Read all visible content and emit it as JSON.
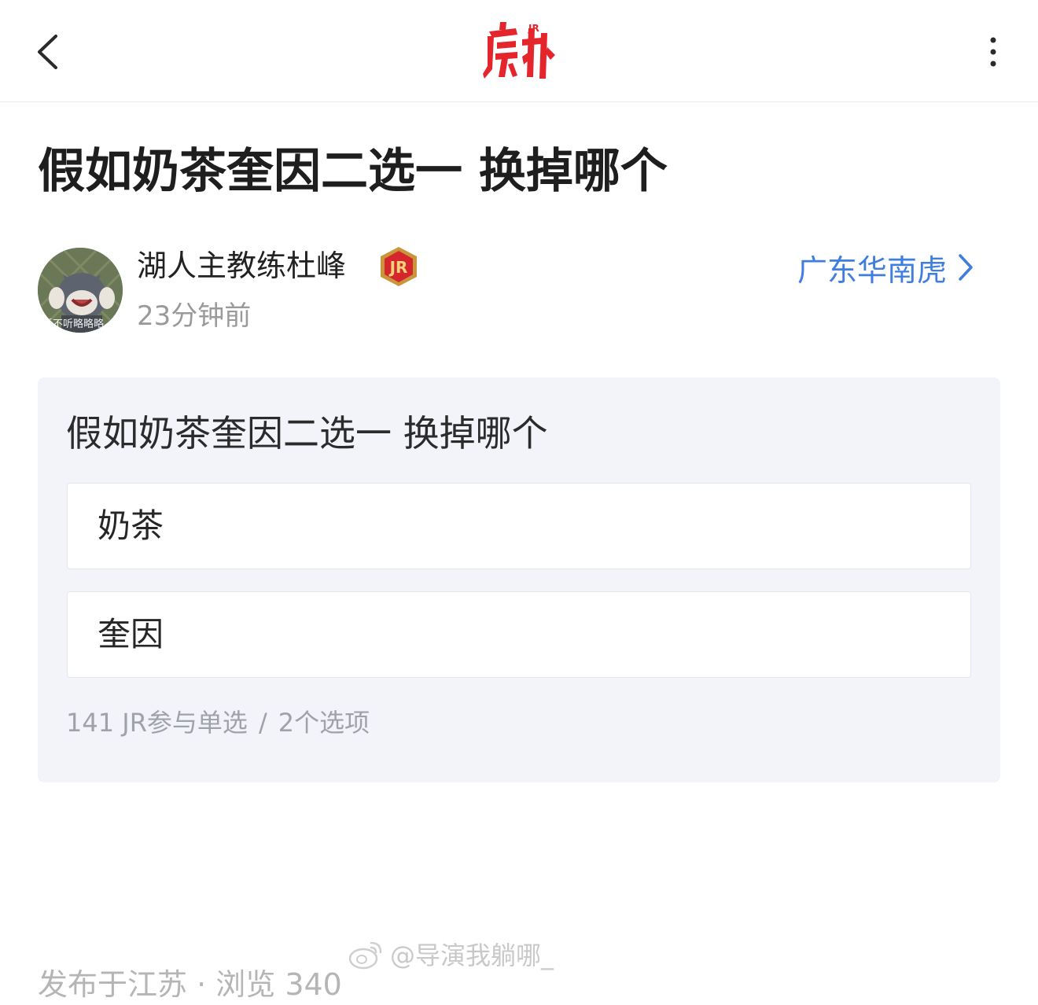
{
  "header": {
    "logo_text": "虎扑",
    "logo_sup": "JR",
    "back_icon": "chevron-left-icon",
    "more_icon": "more-vertical-icon",
    "brand_color": "#e4252c"
  },
  "post": {
    "title": "假如奶茶奎因二选一 换掉哪个",
    "author": {
      "name": "湖人主教练杜峰",
      "time": "23分钟前",
      "badge_text": "JR",
      "avatar_caption": "听不听略略略"
    },
    "board": {
      "label": "广东华南虎",
      "icon": "chevron-right-icon",
      "color": "#3f7de0"
    }
  },
  "poll": {
    "question": "假如奶茶奎因二选一 换掉哪个",
    "options": [
      {
        "label": "奶茶"
      },
      {
        "label": "奎因"
      }
    ],
    "participants": "141 JR参与单选",
    "separator": "/",
    "option_count": "2个选项"
  },
  "watermark": {
    "text": "@导演我躺哪_",
    "icon": "weibo-icon"
  },
  "footer": {
    "text": "发布于江苏 · 浏览 340"
  }
}
